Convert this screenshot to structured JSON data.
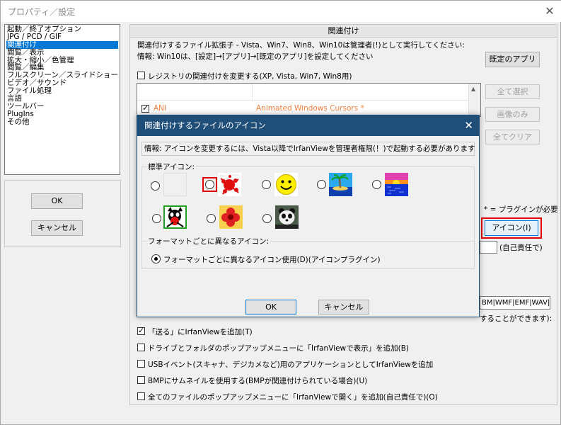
{
  "window": {
    "title": "プロパティ／設定",
    "close_symbol": "✕"
  },
  "nav": {
    "items": [
      "起動／終了オプション",
      "JPG / PCD / GIF",
      "関連付け",
      "閲覧／表示",
      "拡大・縮小／色管理",
      "閲覧／編集",
      "フルスクリーン／スライドショー",
      "ビデオ／サウンド",
      "ファイル処理",
      "言語",
      "ツールバー",
      "PlugIns",
      "その他"
    ],
    "selected_index": 2
  },
  "left_buttons": {
    "ok": "OK",
    "cancel": "キャンセル"
  },
  "page": {
    "header": "関連付け",
    "line1": "関連付けするファイル拡張子 - Vista、Win7、Win8、Win10は管理者(!)として実行してください:",
    "line2": "情報: Win10は、[設定]→[アプリ]→[既定のアプリ]を設定してください",
    "default_apps_button": "既定のアプリ",
    "registry_checkbox": "レジストリの関連付けを変更する(XP, Vista, Win7, Win8用)",
    "list_row": {
      "ext": "ANI",
      "desc": "Animated Windows Cursors *"
    },
    "select_all": "全て選択",
    "images_only": "画像のみ",
    "clear_all": "全てクリア",
    "plugin_note": "* = プラグインが必要",
    "icon_button": "アイコン(I)",
    "self_risk": "(自己責任で)",
    "ext_field_value": "BM|WMF|EMF|WAV|I",
    "partial_hidden_text": "することができます):",
    "options": [
      {
        "label": "「送る」にIrfanViewを追加(T)",
        "checked": true
      },
      {
        "label": "ドライブとフォルダのポップアップメニューに「IrfanViewで表示」を追加(B)",
        "checked": false
      },
      {
        "label": "USBイベント(スキャナ、デジカメなど)用のアプリケーションとしてIrfanViewを追加",
        "checked": false
      },
      {
        "label": "BMPにサムネイルを使用する(BMPが関連付けられている場合)(U)",
        "checked": false
      },
      {
        "label": "全てのファイルのポップアップメニューに「IrfanViewで開く」を追加(自己責任で)(O)",
        "checked": false
      }
    ]
  },
  "dialog": {
    "title": "関連付けするファイルのアイコン",
    "close_symbol": "✕",
    "info": "情報: アイコンを変更するには、Vista以降でIrfanViewを管理者権限(！)で起動する必要があります",
    "standard_icons_label": "標準アイコン:",
    "icons": [
      "blank-icon",
      "red-splat-icon",
      "smiley-icon",
      "palm-island-icon",
      "sunset-icon",
      "cartoon-cat-icon",
      "red-flower-icon",
      "panda-icon"
    ],
    "format_group_label": "フォーマットごとに異なるアイコン:",
    "format_radio_label": "フォーマットごとに異なるアイコン使用(D)(アイコンプラグイン)",
    "ok": "OK",
    "cancel": "キャンセル"
  },
  "colors": {
    "accent": "#0078d7",
    "dialog_title_bg": "#1f4e79",
    "highlight": "#e00000",
    "orange_text": "#f08040"
  }
}
